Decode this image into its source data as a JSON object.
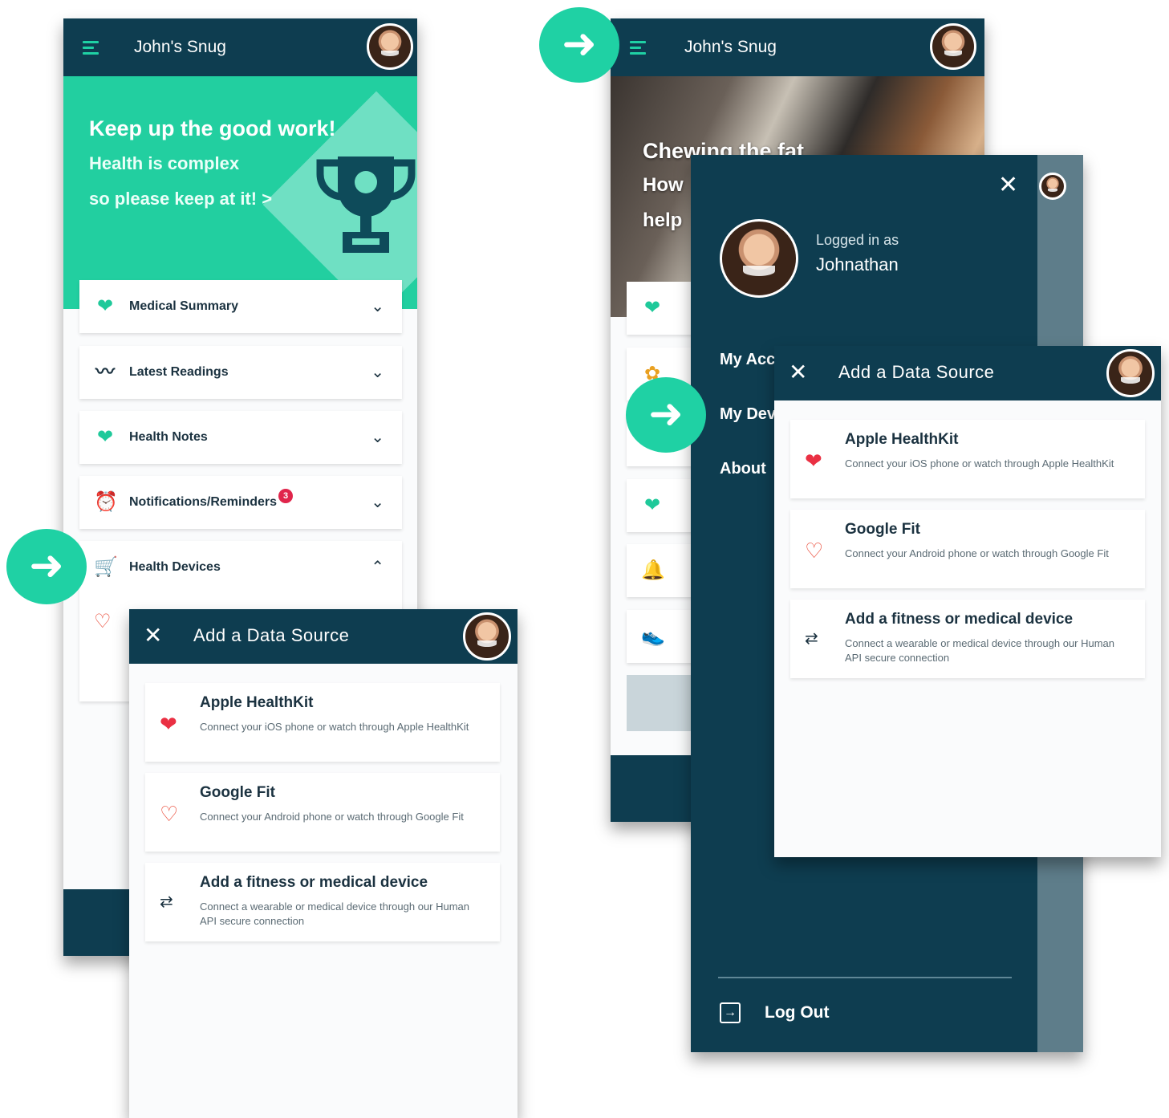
{
  "app_title": "John's Snug",
  "screen1": {
    "hero_title": "Keep up the good work!",
    "hero_line1": "Health is complex",
    "hero_line2": "so please keep at it! >",
    "accordion": [
      {
        "label": "Medical Summary",
        "icon": "heart-check-icon",
        "chevron": "⌄"
      },
      {
        "label": "Latest Readings",
        "icon": "trend-icon",
        "chevron": "⌄"
      },
      {
        "label": "Health Notes",
        "icon": "heart-check-icon",
        "chevron": "⌄"
      },
      {
        "label": "Notifications/Reminders",
        "icon": "alarm-clock-icon",
        "chevron": "⌄",
        "badge": "3"
      },
      {
        "label": "Health Devices",
        "icon": "cart-icon",
        "chevron": "⌃"
      }
    ]
  },
  "screen2": {
    "hero_title": "Chewing the fat",
    "hero_line1": "How",
    "hero_line2": "help"
  },
  "drawer": {
    "logged_in_label": "Logged in as",
    "username": "Johnathan",
    "links": [
      "My Acc",
      "My Dev",
      "About"
    ],
    "logout_label": "Log Out"
  },
  "data_source": {
    "title": "Add a Data Source",
    "items": [
      {
        "name": "Apple HealthKit",
        "desc": "Connect your iOS phone or watch through Apple HealthKit",
        "icon": "heart-icon"
      },
      {
        "name": "Google Fit",
        "desc": "Connect your Android phone or watch through Google Fit",
        "icon": "google-fit-icon"
      },
      {
        "name": "Add a fitness or medical device",
        "desc": "Connect a wearable or medical device through our Human API secure connection",
        "icon": "pulse-icon"
      }
    ]
  },
  "colors": {
    "brand_dark": "#0e3d50",
    "brand_green": "#1fd1a4",
    "badge_red": "#e0254b"
  }
}
